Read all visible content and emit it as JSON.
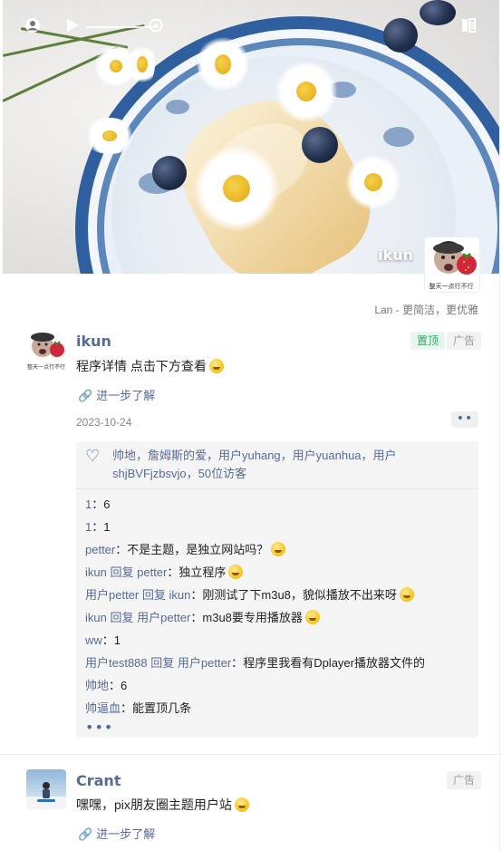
{
  "cover": {
    "username": "ikun",
    "avatar_caption": "整天一点行不行",
    "slogan": "Lan - 更简洁，更优雅",
    "icons": [
      "user-circle-icon",
      "play-icon",
      "refresh-icon",
      "share-icon"
    ]
  },
  "posts": [
    {
      "name": "ikun",
      "avatar_caption": "整天一点行不行",
      "badges": [
        "置顶",
        "广告"
      ],
      "content": "程序详情 点击下方查看",
      "link": "进一步了解",
      "date": "2023-10-24",
      "likes": "帅地，詹姆斯的爱，用户yuhang，用户yuanhua，用户shjBVFjzbsvjo，50位访客",
      "comments": [
        {
          "user": "1",
          "reply_to": "",
          "text": "6",
          "emoji": false
        },
        {
          "user": "1",
          "reply_to": "",
          "text": "1",
          "emoji": false
        },
        {
          "user": "petter",
          "reply_to": "",
          "text": "不是主题，是独立网站吗？",
          "emoji": true
        },
        {
          "user": "ikun",
          "reply_to": "petter",
          "text": "独立程序",
          "emoji": true
        },
        {
          "user": "用户petter",
          "reply_to": "ikun",
          "text": "刚测试了下m3u8，貌似播放不出来呀",
          "emoji": true
        },
        {
          "user": "ikun",
          "reply_to": "用户petter",
          "text": "m3u8要专用播放器",
          "emoji": true
        },
        {
          "user": "ww",
          "reply_to": "",
          "text": "1",
          "emoji": false
        },
        {
          "user": "用户test888",
          "reply_to": "用户petter",
          "text": "程序里我看有Dplayer播放器文件的",
          "emoji": false
        },
        {
          "user": "帅地",
          "reply_to": "",
          "text": "6",
          "emoji": false
        },
        {
          "user": "帅逼血",
          "reply_to": "",
          "text": "能置顶几条",
          "emoji": false
        }
      ],
      "more_comments": "•••",
      "more_button": "••"
    },
    {
      "name": "Crant",
      "badges": [
        "广告"
      ],
      "content": "嘿嘿，pix朋友圈主题用户站",
      "link": "进一步了解"
    }
  ],
  "labels": {
    "reply": "回复",
    "colon": "："
  },
  "colors": {
    "link_blue": "#576b95",
    "badge_green": "#2ea466",
    "plate_blue": "#2f5f9e"
  }
}
